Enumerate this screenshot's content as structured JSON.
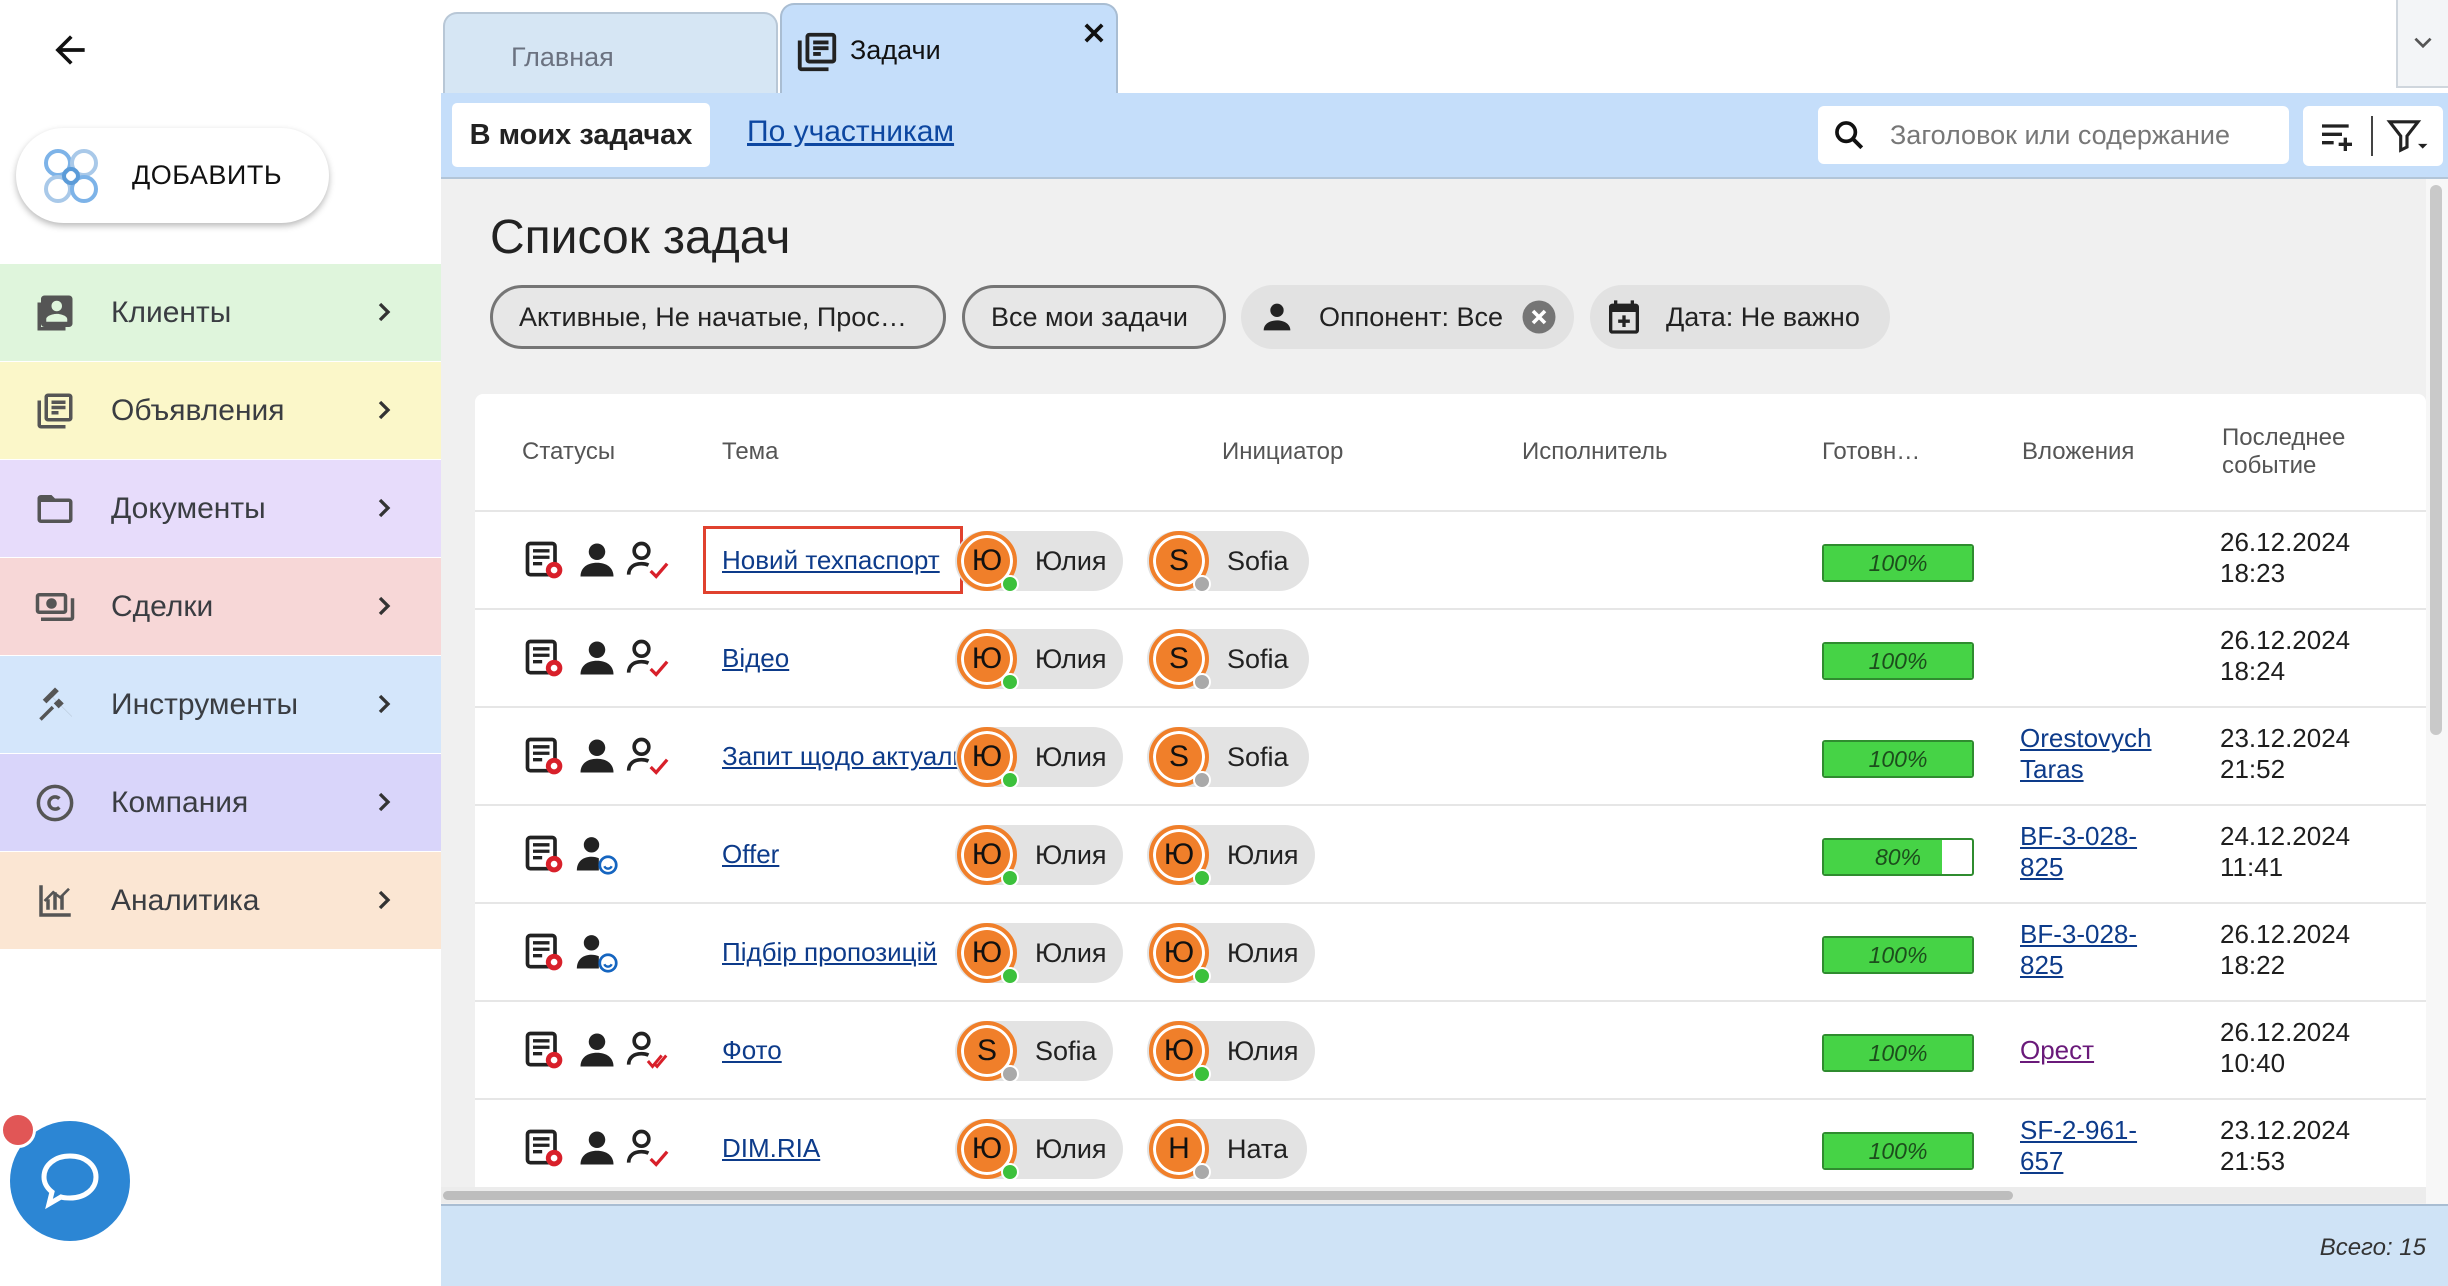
{
  "sidebar": {
    "add_label": "ДОБАВИТЬ",
    "items": [
      {
        "label": "Клиенты",
        "color": "#dff5dc",
        "icon": "contacts-icon"
      },
      {
        "label": "Объявления",
        "color": "#fbf7c9",
        "icon": "listings-icon"
      },
      {
        "label": "Документы",
        "color": "#e7dcfb",
        "icon": "folder-icon"
      },
      {
        "label": "Сделки",
        "color": "#f7d7d7",
        "icon": "money-icon"
      },
      {
        "label": "Инструменты",
        "color": "#d4e6fb",
        "icon": "tools-icon"
      },
      {
        "label": "Компания",
        "color": "#d9d5fa",
        "icon": "copyright-icon"
      },
      {
        "label": "Аналитика",
        "color": "#fbe6d3",
        "icon": "analytics-icon"
      }
    ]
  },
  "tabs": {
    "home": "Главная",
    "tasks": "Задачи"
  },
  "toolbar": {
    "my_tasks": "В моих задачах",
    "by_participants": "По участникам",
    "search_placeholder": "Заголовок или содержание"
  },
  "page_title": "Список задач",
  "filters": {
    "status": "Активные, Не начатые, Прос…",
    "mine": "Все мои задачи",
    "opponent": "Оппонент: Все",
    "date": "Дата: Не важно"
  },
  "table": {
    "headers": {
      "statuses": "Статусы",
      "topic": "Тема",
      "initiator": "Инициатор",
      "executor": "Исполнитель",
      "ready": "Готовн…",
      "attachments": "Вложения",
      "last_event_1": "Последнее",
      "last_event_2": "событие"
    },
    "rows": [
      {
        "topic": "Новий техпаспорт",
        "init": "Юлия",
        "init_letter": "Ю",
        "init_online": true,
        "exec": "Sofia",
        "exec_letter": "S",
        "exec_online": false,
        "ready": "100%",
        "ready_value": 1.0,
        "att1": "",
        "att2": "",
        "date": "26.12.2024",
        "time": "18:23",
        "status_icon": "person-check-icon"
      },
      {
        "topic": "Відео",
        "init": "Юлия",
        "init_letter": "Ю",
        "init_online": true,
        "exec": "Sofia",
        "exec_letter": "S",
        "exec_online": false,
        "ready": "100%",
        "ready_value": 1.0,
        "att1": "",
        "att2": "",
        "date": "26.12.2024",
        "time": "18:24",
        "status_icon": "person-check-icon"
      },
      {
        "topic": "Запит щодо актуальності",
        "init": "Юлия",
        "init_letter": "Ю",
        "init_online": true,
        "exec": "Sofia",
        "exec_letter": "S",
        "exec_online": false,
        "ready": "100%",
        "ready_value": 1.0,
        "att1": "Orestovych",
        "att2": "Taras",
        "date": "23.12.2024",
        "time": "21:52",
        "status_icon": "person-check-icon"
      },
      {
        "topic": "Offer",
        "init": "Юлия",
        "init_letter": "Ю",
        "init_online": true,
        "exec": "Юлия",
        "exec_letter": "Ю",
        "exec_online": true,
        "ready": "80%",
        "ready_value": 0.8,
        "att1": "BF-3-028-",
        "att2": "825",
        "date": "24.12.2024",
        "time": "11:41",
        "status_icon": "person-smile-icon"
      },
      {
        "topic": "Підбір пропозицій",
        "init": "Юлия",
        "init_letter": "Ю",
        "init_online": true,
        "exec": "Юлия",
        "exec_letter": "Ю",
        "exec_online": true,
        "ready": "100%",
        "ready_value": 1.0,
        "att1": "BF-3-028-",
        "att2": "825",
        "date": "26.12.2024",
        "time": "18:22",
        "status_icon": "person-smile-icon"
      },
      {
        "topic": "Фото",
        "init": "Sofia",
        "init_letter": "S",
        "init_online": false,
        "exec": "Юлия",
        "exec_letter": "Ю",
        "exec_online": true,
        "ready": "100%",
        "ready_value": 1.0,
        "att1": "Орест",
        "att2": "",
        "date": "26.12.2024",
        "time": "10:40",
        "status_icon": "person-double-check-icon"
      },
      {
        "topic": "DIM.RIA",
        "init": "Юлия",
        "init_letter": "Ю",
        "init_online": true,
        "exec": "Ната",
        "exec_letter": "Н",
        "exec_online": false,
        "ready": "100%",
        "ready_value": 1.0,
        "att1": "SF-2-961-",
        "att2": "657",
        "date": "23.12.2024",
        "time": "21:53",
        "status_icon": "person-check-icon"
      }
    ]
  },
  "footer": {
    "total": "Всего: 15"
  },
  "colors": {
    "accent_blue": "#c5defa",
    "avatar_orange": "#f07f2a",
    "online_green": "#3cc13c",
    "offline_gray": "#a9a9a9",
    "progress_green": "#46d346",
    "highlight_red": "#e0412e"
  }
}
